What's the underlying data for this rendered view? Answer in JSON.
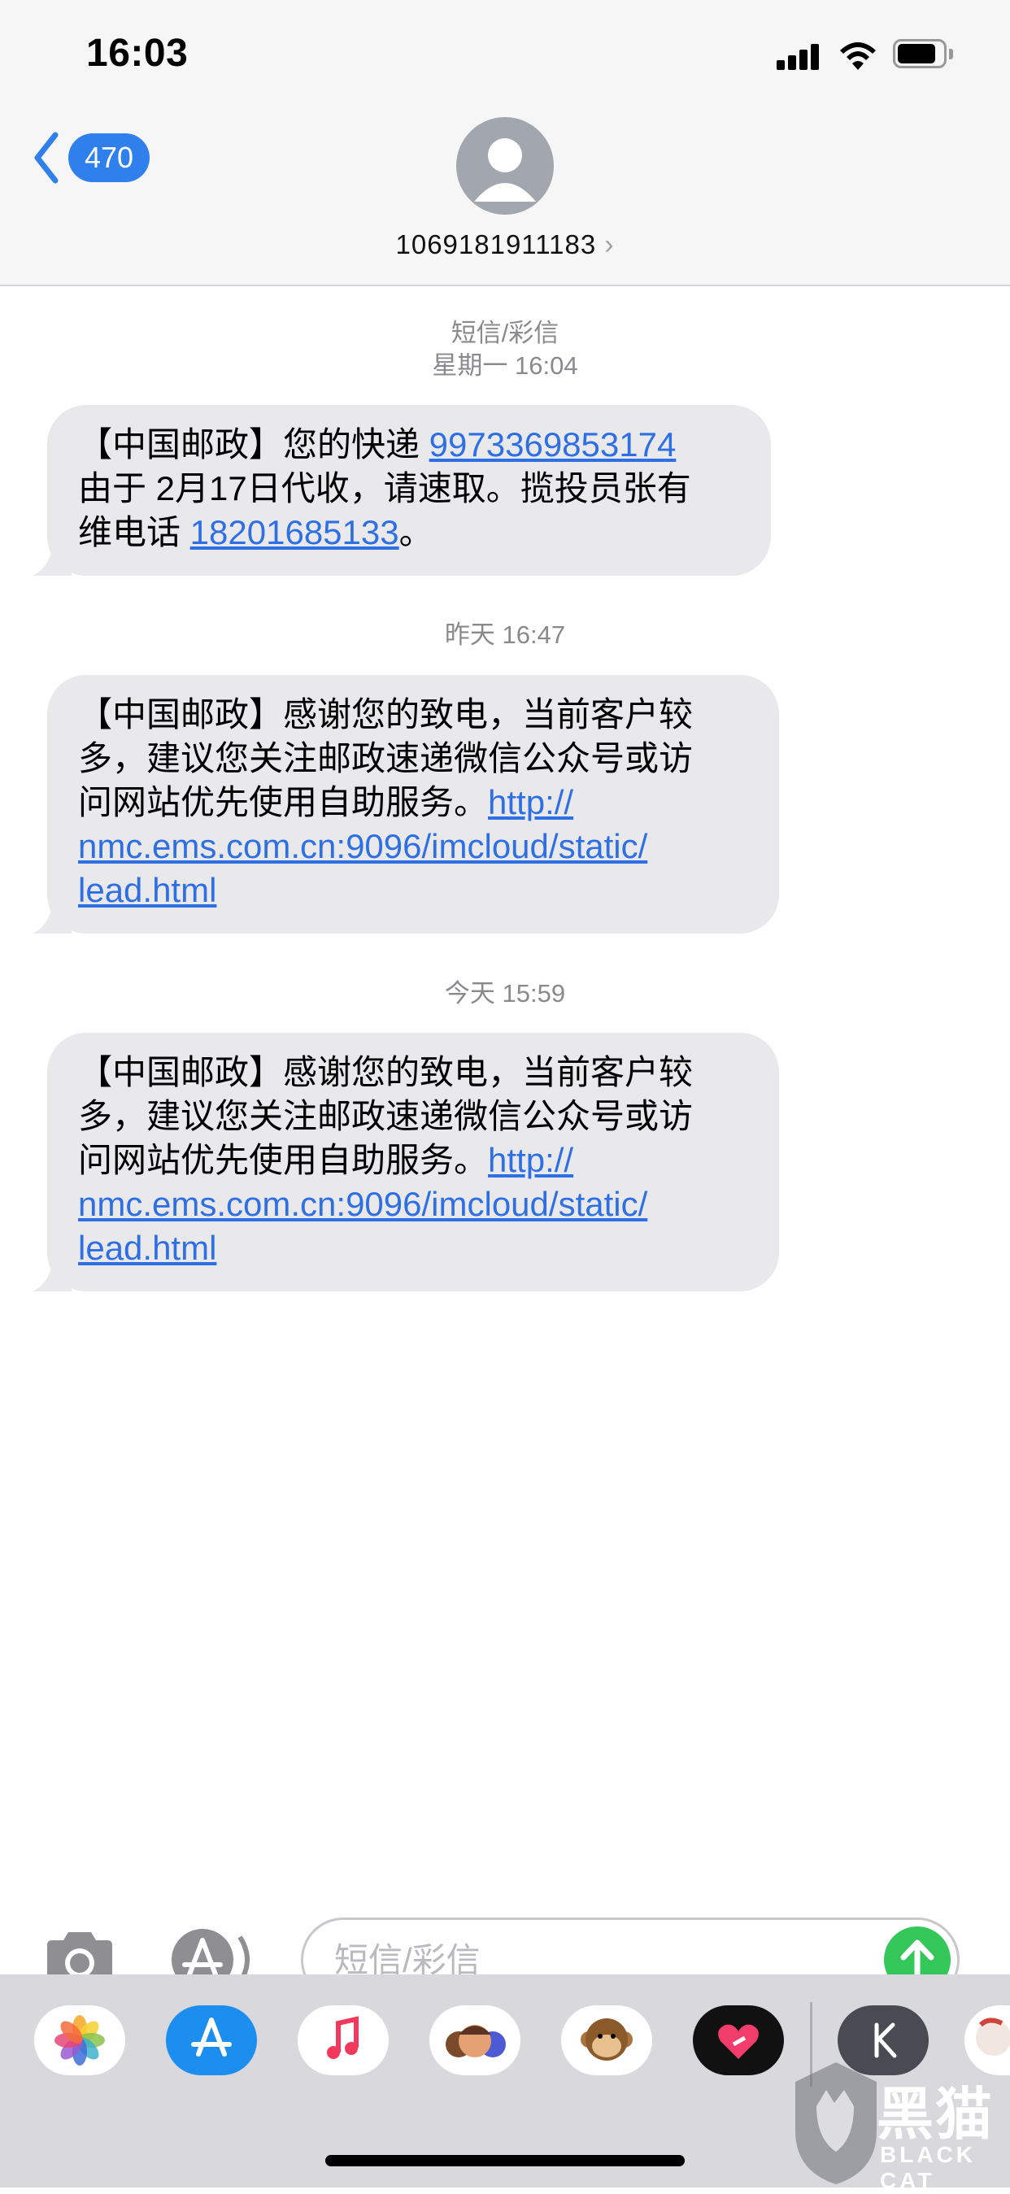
{
  "status_bar": {
    "time": "16:03"
  },
  "header": {
    "back_count": "470",
    "contact": "1069181911183",
    "contact_chevron": "›"
  },
  "thread": {
    "service_label": "短信/彩信",
    "stamp1": "星期一 16:04",
    "msg1": {
      "l1_text": "【中国邮政】您的快递 ",
      "l1_link": "9973369853174",
      "l2": "由于 2月17日代收，请速取。揽投员张有",
      "l3_text": "维电话 ",
      "l3_link": "18201685133",
      "l3_end": "。"
    },
    "stamp2": "昨天 16:47",
    "msg2": {
      "l1": "【中国邮政】感谢您的致电，当前客户较",
      "l2": "多，建议您关注邮政速递微信公众号或访",
      "l3_text": "问网站优先使用自助服务。",
      "l3_link": "http://",
      "l4_link": "nmc.ems.com.cn:9096/imcloud/static/",
      "l5_link": "lead.html"
    },
    "stamp3": "今天 15:59",
    "msg3": {
      "l1": "【中国邮政】感谢您的致电，当前客户较",
      "l2": "多，建议您关注邮政速递微信公众号或访",
      "l3_text": "问网站优先使用自助服务。",
      "l3_link": "http://",
      "l4_link": "nmc.ems.com.cn:9096/imcloud/static/",
      "l5_link": "lead.html"
    }
  },
  "input": {
    "placeholder": "短信/彩信"
  },
  "app_drawer": {
    "apps": [
      "photos-icon",
      "app-store-icon",
      "music-icon",
      "memoji-icon",
      "animoji-icon",
      "heart-app-icon",
      "k-app-icon",
      "sticker-app-icon"
    ]
  },
  "watermark": {
    "text": "黑猫",
    "sub": "BLACK CAT"
  },
  "colors": {
    "link": "#2f6fe4",
    "bubble": "#e9e9eb",
    "accent": "#2f80ed",
    "send": "#34c759"
  }
}
